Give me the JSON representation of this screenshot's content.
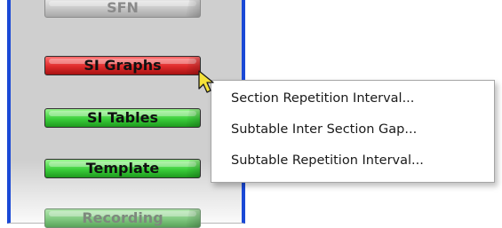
{
  "buttons": {
    "sfn": "SFN",
    "si_graphs": "SI Graphs",
    "si_tables": "SI Tables",
    "template": "Template",
    "recording": "Recording"
  },
  "context_menu": {
    "items": [
      "Section Repetition Interval...",
      "Subtable Inter Section Gap...",
      "Subtable Repetition Interval..."
    ]
  },
  "colors": {
    "panel_border": "#1a49d6",
    "panel_background": "#cfcfcf",
    "button_active": "#de2b2b",
    "button_default": "#3bcf3b",
    "cursor": "#f5e23a"
  },
  "icons": {
    "pointer": "arrow-cursor-icon"
  }
}
